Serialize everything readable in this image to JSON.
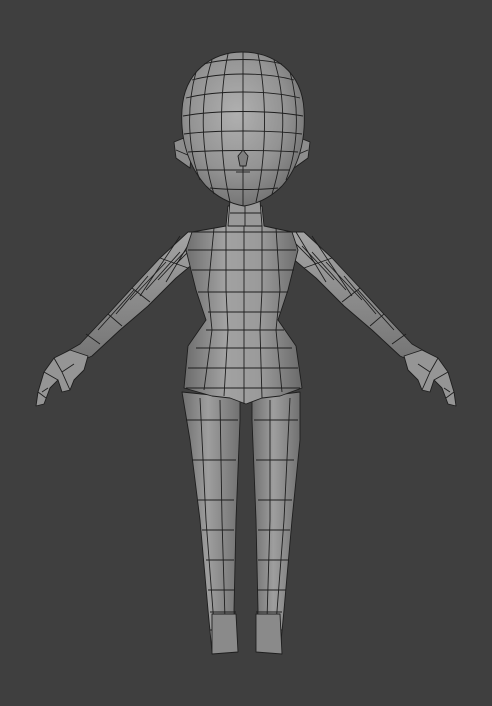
{
  "viewport": {
    "background": "#3f3f3f",
    "mesh_fill": "#8f8f8f",
    "mesh_highlight": "#a6a6a6",
    "mesh_shadow": "#6a6a6a",
    "wire_color": "#1e1e1e"
  },
  "model": {
    "pose": "T-pose",
    "display": "solid-with-wireframe"
  }
}
